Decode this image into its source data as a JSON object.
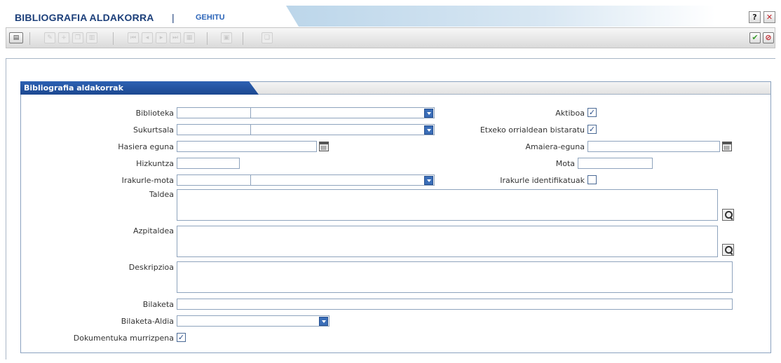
{
  "header": {
    "title": "BIBLIOGRAFIA ALDAKORRA",
    "separator": "|",
    "subtitle": "GEHITU",
    "help_icon": "question-icon",
    "close_icon": "close-icon"
  },
  "toolbar": {
    "icons": [
      "menu-icon",
      "edit-icon",
      "add-icon",
      "copy-icon",
      "delete-icon",
      "first-icon",
      "prev-icon",
      "next-icon",
      "last-icon",
      "list-icon",
      "print-icon",
      "export-icon",
      "accept-icon",
      "cancel-icon"
    ]
  },
  "panel": {
    "title": "Bibliografia aldakorrak"
  },
  "form": {
    "biblioteka": {
      "label": "Biblioteka",
      "code": "",
      "value": ""
    },
    "sukurtsala": {
      "label": "Sukurtsala",
      "code": "",
      "value": ""
    },
    "hasiera_eguna": {
      "label": "Hasiera eguna",
      "value": ""
    },
    "hizkuntza": {
      "label": "Hizkuntza",
      "value": ""
    },
    "irakurle_mota": {
      "label": "Irakurle-mota",
      "code": "",
      "value": ""
    },
    "aktiboa": {
      "label": "Aktiboa",
      "checked": true
    },
    "etxeko": {
      "label": "Etxeko orrialdean bistaratu",
      "checked": true
    },
    "amaiera_eguna": {
      "label": "Amaiera-eguna",
      "value": ""
    },
    "mota": {
      "label": "Mota",
      "value": ""
    },
    "irakurle_identifikatuak": {
      "label": "Irakurle identifikatuak",
      "checked": false
    },
    "taldea": {
      "label": "Taldea",
      "value": ""
    },
    "azpitaldea": {
      "label": "Azpitaldea",
      "value": ""
    },
    "deskripzioa": {
      "label": "Deskripzioa",
      "value": ""
    },
    "bilaketa": {
      "label": "Bilaketa",
      "value": ""
    },
    "bilaketa_aldia": {
      "label": "Bilaketa-Aldia",
      "value": ""
    },
    "dokumentuka": {
      "label": "Dokumentuka murrizpena",
      "checked": true
    },
    "check_mark": "✓"
  },
  "colors": {
    "title": "#1c3f7a",
    "subtitle": "#2b64b8",
    "panel_tab": "#1c4890",
    "border": "#8ea3bd"
  }
}
